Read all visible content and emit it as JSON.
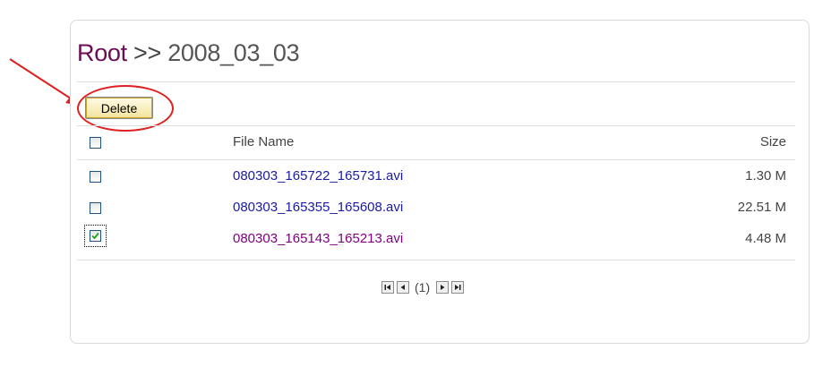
{
  "breadcrumb": {
    "root": "Root",
    "separator": " >> ",
    "folder": "2008_03_03"
  },
  "toolbar": {
    "delete_label": "Delete"
  },
  "table": {
    "headers": {
      "file_name": "File Name",
      "size": "Size"
    },
    "rows": [
      {
        "name": "080303_165722_165731.avi",
        "size": "1.30 M",
        "checked": false,
        "link_color": "#1a1aa6"
      },
      {
        "name": "080303_165355_165608.avi",
        "size": "22.51 M",
        "checked": false,
        "link_color": "#1a1aa6"
      },
      {
        "name": "080303_165143_165213.avi",
        "size": "4.48 M",
        "checked": true,
        "link_color": "#800080"
      }
    ]
  },
  "pagination": {
    "page_label": "(1)",
    "icons": [
      "first-page-icon",
      "prev-page-icon",
      "next-page-icon",
      "last-page-icon"
    ]
  },
  "colors": {
    "annotation_red": "#e02020",
    "breadcrumb_root": "#6b0d55",
    "link": "#1a1aa6",
    "visited_link": "#800080",
    "delete_button": "#f3e39a"
  }
}
